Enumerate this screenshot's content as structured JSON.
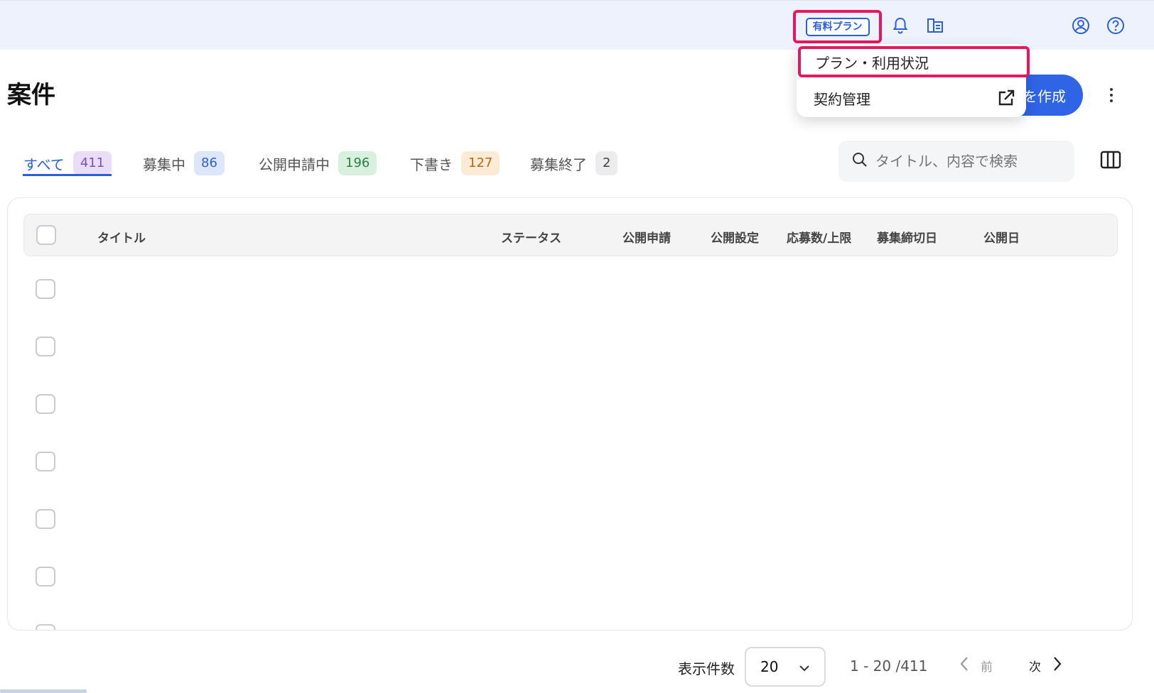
{
  "header": {
    "plan_badge": "有料プラン",
    "icons": [
      "bell-icon",
      "document-book-icon",
      "account-icon",
      "help-icon"
    ]
  },
  "dropdown": {
    "items": [
      {
        "label": "プラン・利用状況"
      },
      {
        "label": "契約管理",
        "icon": "external-link-icon"
      }
    ]
  },
  "page": {
    "title": "案件",
    "create_button": "を作成"
  },
  "tabs": [
    {
      "label": "すべて",
      "count": "411",
      "color": "#e9ddf8",
      "text_color": "#7b4fc2"
    },
    {
      "label": "募集中",
      "count": "86",
      "color": "#dde7fb",
      "text_color": "#2f5fd3"
    },
    {
      "label": "公開申請中",
      "count": "196",
      "color": "#d8f0de",
      "text_color": "#2e7d45"
    },
    {
      "label": "下書き",
      "count": "127",
      "color": "#fdebd6",
      "text_color": "#b46a1c"
    },
    {
      "label": "募集終了",
      "count": "2",
      "color": "#ececee",
      "text_color": "#444444"
    }
  ],
  "search": {
    "placeholder": "タイトル、内容で検索"
  },
  "table": {
    "columns": [
      "タイトル",
      "ステータス",
      "公開申請",
      "公開設定",
      "応募数/上限",
      "募集締切日",
      "公開日"
    ]
  },
  "footer": {
    "per_page_label": "表示件数",
    "per_page_value": "20",
    "range": "1 - 20 /411",
    "prev": "前",
    "next": "次"
  },
  "colors": {
    "accent": "#2b5fd9",
    "highlight": "#e8175d"
  }
}
